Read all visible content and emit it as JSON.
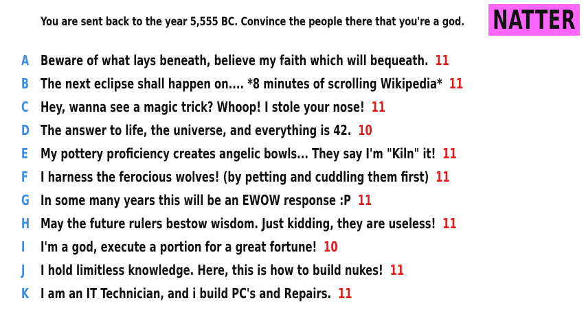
{
  "prompt": "You are sent back to the year 5,555 BC. Convince the people there that you're a god.",
  "logo": "NATTER",
  "colors": {
    "letter": "#3a8ee6",
    "score": "#e21b1b",
    "logo_bg": "#ff66ff"
  },
  "answers": [
    {
      "letter": "A",
      "text": "Beware of what lays beneath, believe my faith which will bequeath.",
      "score": "11"
    },
    {
      "letter": "B",
      "text": "The next eclipse shall happen on.... *8 minutes of scrolling Wikipedia*",
      "score": "11"
    },
    {
      "letter": "C",
      "text": "Hey, wanna see a magic trick? Whoop! I stole your nose!",
      "score": "11"
    },
    {
      "letter": "D",
      "text": "The answer to life, the universe, and everything is 42.",
      "score": "10"
    },
    {
      "letter": "E",
      "text": "My pottery proficiency creates angelic bowls... They say I'm \"Kiln\" it!",
      "score": "11"
    },
    {
      "letter": "F",
      "text": "I harness the ferocious wolves! (by petting and cuddling them first)",
      "score": "11"
    },
    {
      "letter": "G",
      "text": "In some many years this will be an EWOW response :P",
      "score": "11"
    },
    {
      "letter": "H",
      "text": "May the future rulers bestow wisdom. Just kidding, they are useless!",
      "score": "11"
    },
    {
      "letter": "I",
      "text": "I'm a god, execute a portion for a great fortune!",
      "score": "10"
    },
    {
      "letter": "J",
      "text": "I hold limitless knowledge. Here, this is how to build nukes!",
      "score": "11"
    },
    {
      "letter": "K",
      "text": "I am an IT Technician, and i build PC's and Repairs.",
      "score": "11"
    }
  ]
}
